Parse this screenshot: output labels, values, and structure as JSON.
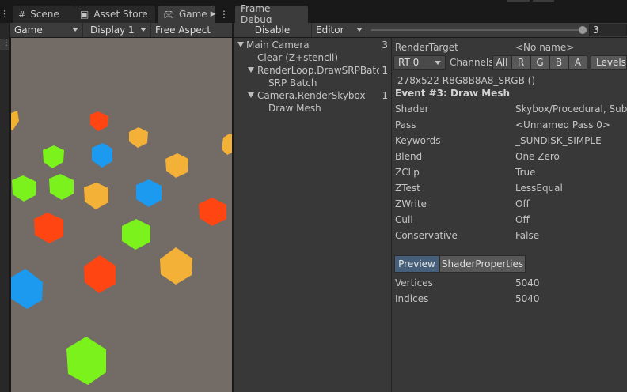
{
  "tabs": {
    "scene": "Scene",
    "asset_store": "Asset Store",
    "game": "Game",
    "frame_debug": "Frame Debug"
  },
  "game_toolbar": {
    "view_mode": "Game",
    "display": "Display 1",
    "aspect": "Free Aspect"
  },
  "frame_debug": {
    "disable_label": "Disable",
    "target": "Editor",
    "event_index": "3",
    "tree": [
      {
        "label": "Main Camera",
        "count": "3"
      },
      {
        "label": "Clear (Z+stencil)",
        "count": ""
      },
      {
        "label": "RenderLoop.DrawSRPBatcher",
        "count": "1"
      },
      {
        "label": "SRP Batch",
        "count": ""
      },
      {
        "label": "Camera.RenderSkybox",
        "count": "1"
      },
      {
        "label": "Draw Mesh",
        "count": ""
      }
    ],
    "render_target_label": "RenderTarget",
    "render_target_value": "<No name>",
    "rt_select": "RT 0",
    "channels_label": "Channels",
    "channels": [
      "All",
      "R",
      "G",
      "B",
      "A"
    ],
    "levels_label": "Levels",
    "format": "278x522 R8G8B8A8_SRGB ()",
    "event_title": "Event #3: Draw Mesh",
    "properties": [
      {
        "name": "Shader",
        "value": "Skybox/Procedural, SubS"
      },
      {
        "name": "Pass",
        "value": "<Unnamed Pass 0>"
      },
      {
        "name": "Keywords",
        "value": "_SUNDISK_SIMPLE"
      },
      {
        "name": "Blend",
        "value": "One Zero"
      },
      {
        "name": "ZClip",
        "value": "True"
      },
      {
        "name": "ZTest",
        "value": "LessEqual"
      },
      {
        "name": "ZWrite",
        "value": "Off"
      },
      {
        "name": "Cull",
        "value": "Off"
      },
      {
        "name": "Conservative",
        "value": "False"
      }
    ],
    "preview_tab": "Preview",
    "shader_properties_tab": "ShaderProperties",
    "stats": [
      {
        "name": "Vertices",
        "value": "5040"
      },
      {
        "name": "Indices",
        "value": "5040"
      }
    ]
  }
}
